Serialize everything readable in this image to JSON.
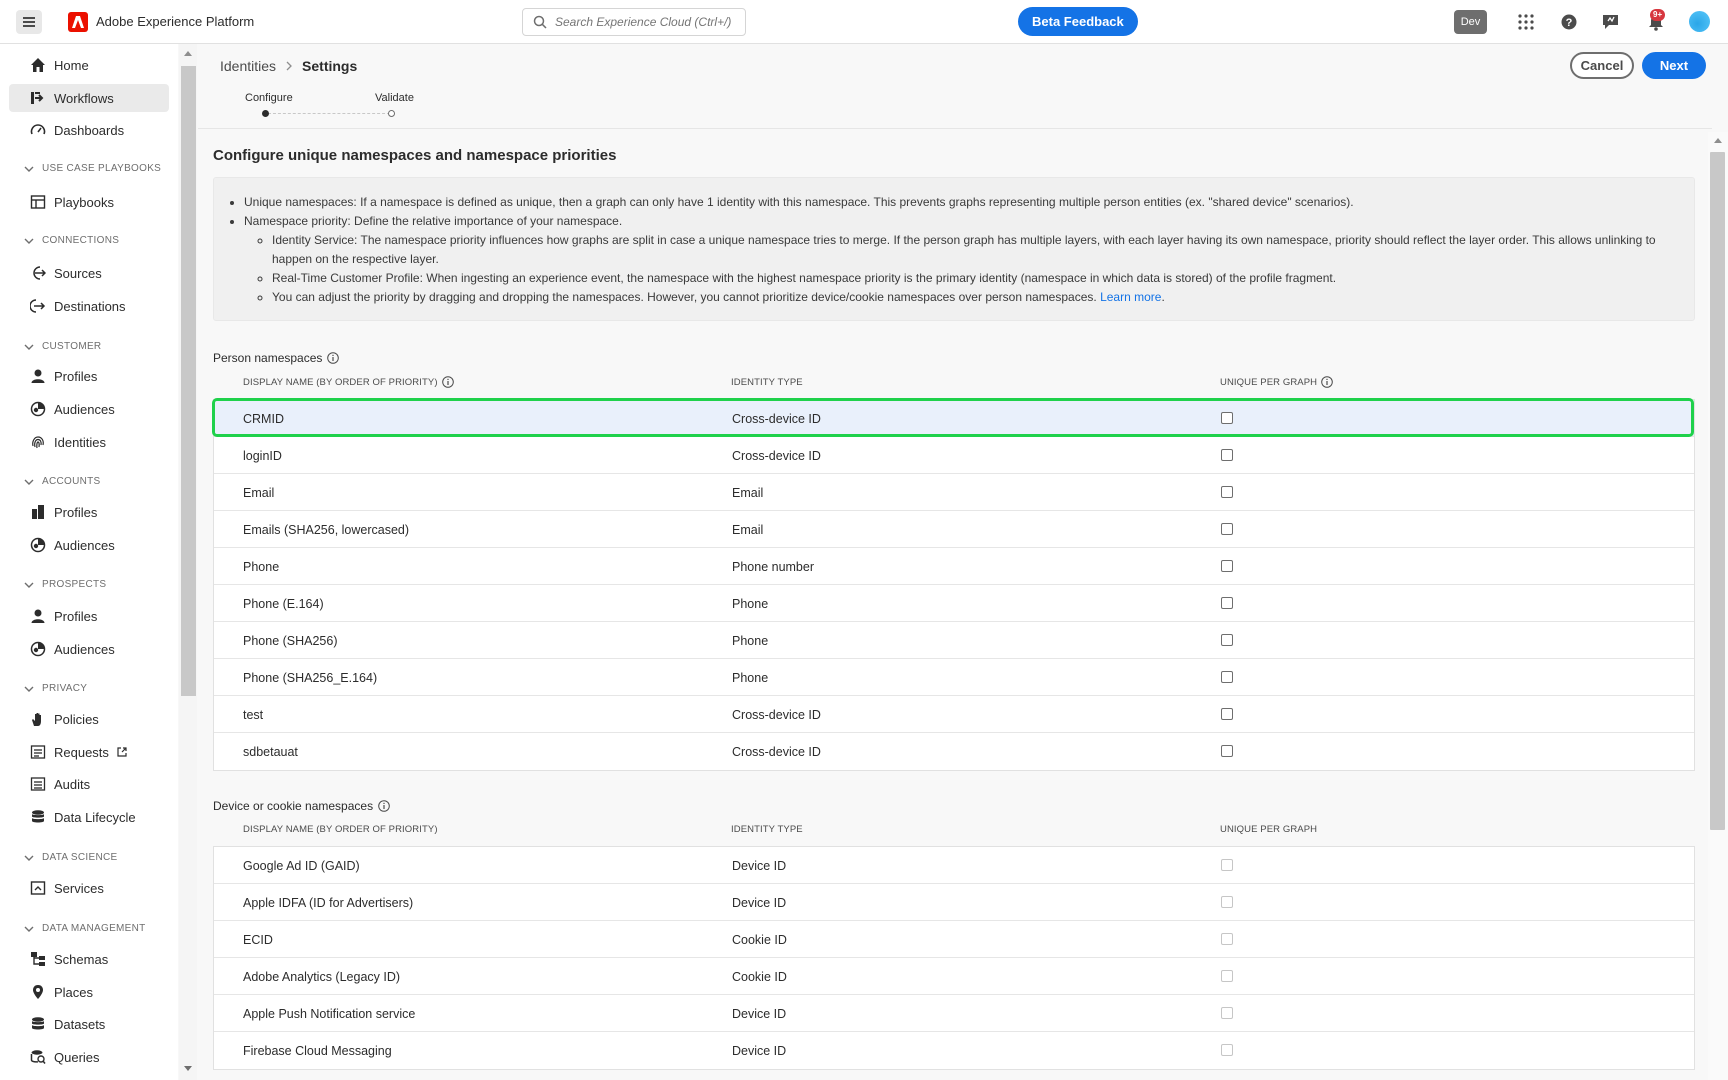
{
  "topbar": {
    "app_title": "Adobe Experience Platform",
    "search_placeholder": "Search Experience Cloud (Ctrl+/)",
    "beta_feedback": "Beta Feedback",
    "env": "Dev",
    "notification_count": "9+",
    "icons": [
      "menu-icon",
      "adobe-logo",
      "search-icon",
      "apps-grid-icon",
      "help-icon",
      "feedback-icon",
      "bell-icon",
      "avatar"
    ]
  },
  "sidebar": {
    "items_top": [
      {
        "label": "Home",
        "icon": "home-icon"
      },
      {
        "label": "Workflows",
        "icon": "workflow-icon",
        "active": true
      },
      {
        "label": "Dashboards",
        "icon": "dashboard-icon"
      }
    ],
    "sections": {
      "use_case": "USE CASE PLAYBOOKS",
      "connections": "CONNECTIONS",
      "customer": "CUSTOMER",
      "accounts": "ACCOUNTS",
      "prospects": "PROSPECTS",
      "privacy": "PRIVACY",
      "data_science": "DATA SCIENCE",
      "data_management": "DATA MANAGEMENT"
    },
    "labels": {
      "playbooks": "Playbooks",
      "sources": "Sources",
      "destinations": "Destinations",
      "customer_profiles": "Profiles",
      "customer_audiences": "Audiences",
      "identities": "Identities",
      "accounts_profiles": "Profiles",
      "accounts_audiences": "Audiences",
      "prospects_profiles": "Profiles",
      "prospects_audiences": "Audiences",
      "policies": "Policies",
      "requests": "Requests",
      "audits": "Audits",
      "data_lifecycle": "Data Lifecycle",
      "services": "Services",
      "schemas": "Schemas",
      "places": "Places",
      "datasets": "Datasets",
      "queries": "Queries"
    }
  },
  "header": {
    "breadcrumb_parent": "Identities",
    "breadcrumb_current": "Settings",
    "cancel": "Cancel",
    "next": "Next",
    "steps": [
      "Configure",
      "Validate"
    ],
    "active_step": "Configure"
  },
  "content": {
    "title": "Configure unique namespaces and namespace priorities",
    "info": {
      "b1": "Unique namespaces: If a namespace is defined as unique, then a graph can only have 1 identity with this namespace. This prevents graphs representing multiple person entities (ex. \"shared device\" scenarios).",
      "b2": "Namespace priority: Define the relative importance of your namespace.",
      "b2a": "Identity Service: The namespace priority influences how graphs are split in case a unique namespace tries to merge. If the person graph has multiple layers, with each layer having its own namespace, priority should reflect the layer order. This allows unlinking to happen on the respective layer.",
      "b2b": "Real-Time Customer Profile: When ingesting an experience event, the namespace with the highest namespace priority is the primary identity (namespace in which data is stored) of the profile fragment.",
      "b2c": "You can adjust the priority by dragging and dropping the namespaces. However, you cannot prioritize device/cookie namespaces over person namespaces.",
      "learn_more": "Learn more"
    },
    "columns": {
      "display_name": "DISPLAY NAME (BY ORDER OF PRIORITY)",
      "identity_type": "IDENTITY TYPE",
      "unique": "UNIQUE PER GRAPH"
    },
    "person": {
      "caption": "Person namespaces",
      "rows": [
        {
          "name": "CRMID",
          "type": "Cross-device ID"
        },
        {
          "name": "loginID",
          "type": "Cross-device ID"
        },
        {
          "name": "Email",
          "type": "Email"
        },
        {
          "name": "Emails (SHA256, lowercased)",
          "type": "Email"
        },
        {
          "name": "Phone",
          "type": "Phone number"
        },
        {
          "name": "Phone (E.164)",
          "type": "Phone"
        },
        {
          "name": "Phone (SHA256)",
          "type": "Phone"
        },
        {
          "name": "Phone (SHA256_E.164)",
          "type": "Phone"
        },
        {
          "name": "test",
          "type": "Cross-device ID"
        },
        {
          "name": "sdbetauat",
          "type": "Cross-device ID"
        }
      ]
    },
    "device": {
      "caption": "Device or cookie namespaces",
      "rows": [
        {
          "name": "Google Ad ID (GAID)",
          "type": "Device ID"
        },
        {
          "name": "Apple IDFA (ID for Advertisers)",
          "type": "Device ID"
        },
        {
          "name": "ECID",
          "type": "Cookie ID"
        },
        {
          "name": "Adobe Analytics (Legacy ID)",
          "type": "Cookie ID"
        },
        {
          "name": "Apple Push Notification service",
          "type": "Device ID"
        },
        {
          "name": "Firebase Cloud Messaging",
          "type": "Device ID"
        }
      ]
    }
  }
}
